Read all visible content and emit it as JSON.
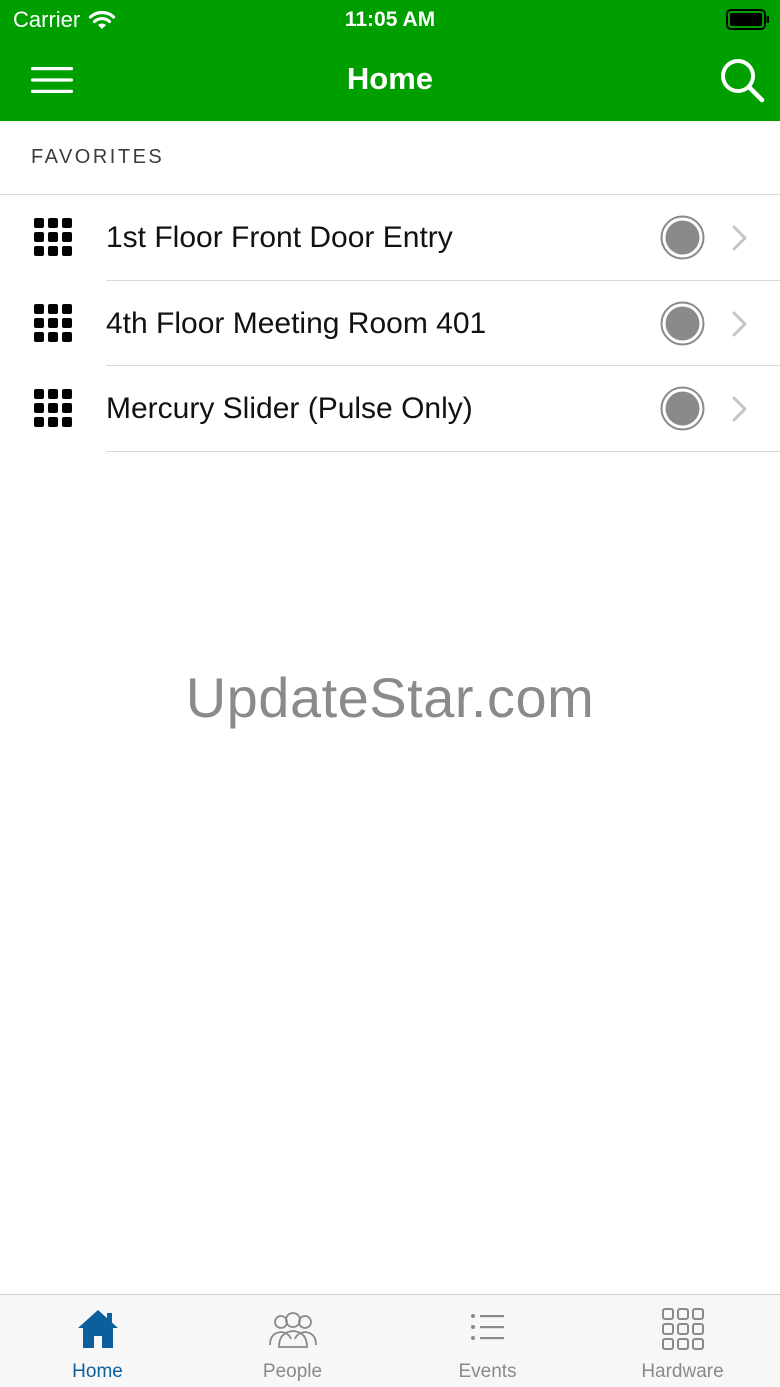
{
  "status_bar": {
    "carrier": "Carrier",
    "time": "11:05 AM"
  },
  "nav": {
    "title": "Home",
    "menu_icon": "hamburger-menu-icon",
    "search_icon": "search-icon"
  },
  "favorites": {
    "header": "FAVORITES",
    "items": [
      {
        "label": "1st Floor Front Door Entry",
        "icon": "keypad-grid-icon"
      },
      {
        "label": "4th Floor Meeting Room 401",
        "icon": "keypad-grid-icon"
      },
      {
        "label": "Mercury Slider (Pulse Only)",
        "icon": "keypad-grid-icon"
      }
    ]
  },
  "watermark": "UpdateStar.com",
  "tabbar": {
    "tabs": [
      {
        "label": "Home",
        "icon": "home-icon",
        "active": true
      },
      {
        "label": "People",
        "icon": "people-icon",
        "active": false
      },
      {
        "label": "Events",
        "icon": "list-icon",
        "active": false
      },
      {
        "label": "Hardware",
        "icon": "hardware-grid-icon",
        "active": false
      }
    ]
  },
  "colors": {
    "header_bg": "#009f00",
    "active_tab": "#0a5f9c",
    "inactive_tab": "#8a8a8a",
    "status_dot": "#8a8a8a"
  }
}
